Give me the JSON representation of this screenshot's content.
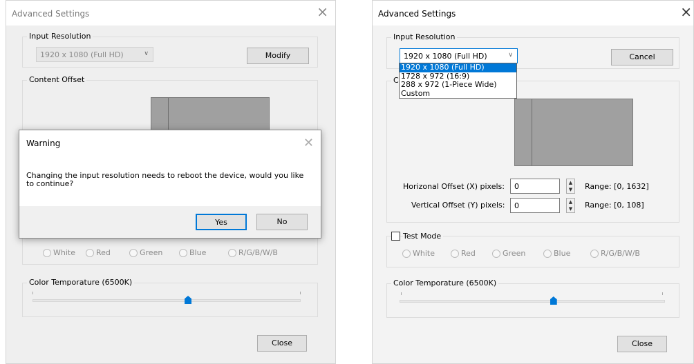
{
  "left": {
    "title": "Advanced Settings",
    "close_glyph": "×",
    "input_resolution": {
      "group_label": "Input Resolution",
      "selected": "1920 x 1080 (Full HD)",
      "button": "Modify"
    },
    "content_offset": {
      "group_label": "Content Offset"
    },
    "test_mode": {
      "radios": [
        "White",
        "Red",
        "Green",
        "Blue",
        "R/G/B/W/B"
      ]
    },
    "color_temp": {
      "group_label": "Color Temporature (6500K)",
      "value_fraction": 0.58
    },
    "close_button": "Close",
    "warning": {
      "title": "Warning",
      "message": "Changing the input resolution needs to reboot the device, would you like to continue?",
      "yes": "Yes",
      "no": "No"
    }
  },
  "right": {
    "title": "Advanced Settings",
    "close_glyph": "×",
    "input_resolution": {
      "group_label": "Input Resolution",
      "selected": "1920 x 1080 (Full HD)",
      "button": "Cancel",
      "options": [
        "1920 x 1080 (Full HD)",
        "1728 x 972 (16:9)",
        "288 x 972 (1-Piece Wide)",
        "Custom"
      ]
    },
    "content_offset": {
      "group_label_partial": "Co",
      "h_label": "Horizonal Offset (X) pixels:",
      "h_value": "0",
      "h_range": "Range: [0, 1632]",
      "v_label": "Vertical Offset (Y) pixels:",
      "v_value": "0",
      "v_range": "Range: [0, 108]"
    },
    "test_mode": {
      "label": "Test Mode",
      "radios": [
        "White",
        "Red",
        "Green",
        "Blue",
        "R/G/B/W/B"
      ]
    },
    "color_temp": {
      "group_label": "Color Temporature (6500K)",
      "value_fraction": 0.58
    },
    "close_button": "Close"
  }
}
